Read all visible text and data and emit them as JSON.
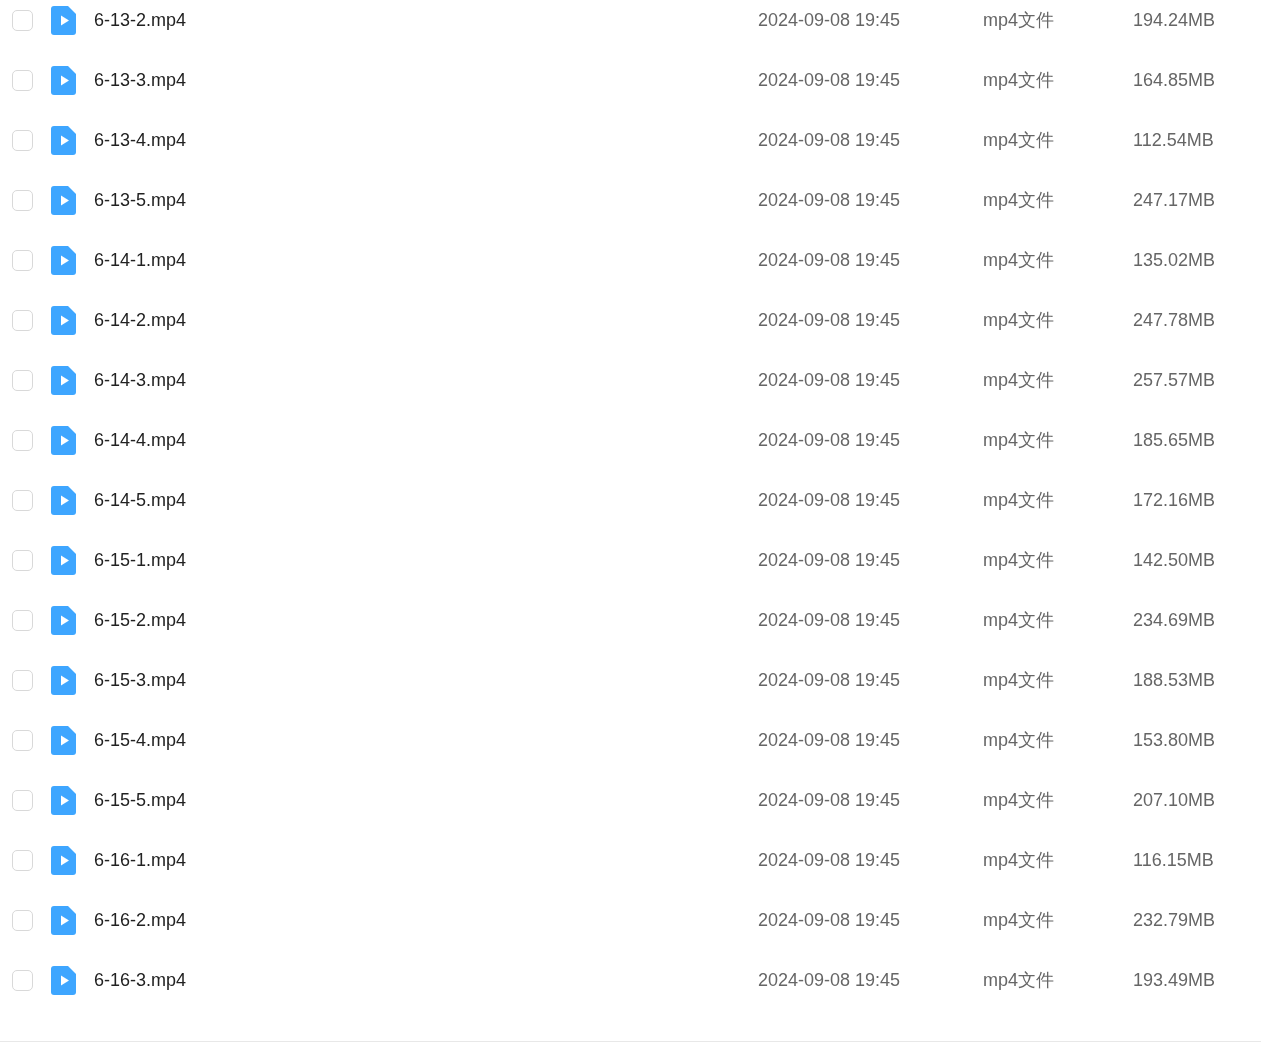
{
  "files": [
    {
      "name": "6-13-2.mp4",
      "modified": "2024-09-08 19:45",
      "type": "mp4文件",
      "size": "194.24MB",
      "checked": false
    },
    {
      "name": "6-13-3.mp4",
      "modified": "2024-09-08 19:45",
      "type": "mp4文件",
      "size": "164.85MB",
      "checked": false
    },
    {
      "name": "6-13-4.mp4",
      "modified": "2024-09-08 19:45",
      "type": "mp4文件",
      "size": "112.54MB",
      "checked": false
    },
    {
      "name": "6-13-5.mp4",
      "modified": "2024-09-08 19:45",
      "type": "mp4文件",
      "size": "247.17MB",
      "checked": false
    },
    {
      "name": "6-14-1.mp4",
      "modified": "2024-09-08 19:45",
      "type": "mp4文件",
      "size": "135.02MB",
      "checked": false
    },
    {
      "name": "6-14-2.mp4",
      "modified": "2024-09-08 19:45",
      "type": "mp4文件",
      "size": "247.78MB",
      "checked": false
    },
    {
      "name": "6-14-3.mp4",
      "modified": "2024-09-08 19:45",
      "type": "mp4文件",
      "size": "257.57MB",
      "checked": false
    },
    {
      "name": "6-14-4.mp4",
      "modified": "2024-09-08 19:45",
      "type": "mp4文件",
      "size": "185.65MB",
      "checked": false
    },
    {
      "name": "6-14-5.mp4",
      "modified": "2024-09-08 19:45",
      "type": "mp4文件",
      "size": "172.16MB",
      "checked": false
    },
    {
      "name": "6-15-1.mp4",
      "modified": "2024-09-08 19:45",
      "type": "mp4文件",
      "size": "142.50MB",
      "checked": false
    },
    {
      "name": "6-15-2.mp4",
      "modified": "2024-09-08 19:45",
      "type": "mp4文件",
      "size": "234.69MB",
      "checked": false
    },
    {
      "name": "6-15-3.mp4",
      "modified": "2024-09-08 19:45",
      "type": "mp4文件",
      "size": "188.53MB",
      "checked": false
    },
    {
      "name": "6-15-4.mp4",
      "modified": "2024-09-08 19:45",
      "type": "mp4文件",
      "size": "153.80MB",
      "checked": false
    },
    {
      "name": "6-15-5.mp4",
      "modified": "2024-09-08 19:45",
      "type": "mp4文件",
      "size": "207.10MB",
      "checked": false
    },
    {
      "name": "6-16-1.mp4",
      "modified": "2024-09-08 19:45",
      "type": "mp4文件",
      "size": "116.15MB",
      "checked": false
    },
    {
      "name": "6-16-2.mp4",
      "modified": "2024-09-08 19:45",
      "type": "mp4文件",
      "size": "232.79MB",
      "checked": false
    },
    {
      "name": "6-16-3.mp4",
      "modified": "2024-09-08 19:45",
      "type": "mp4文件",
      "size": "193.49MB",
      "checked": false
    }
  ]
}
